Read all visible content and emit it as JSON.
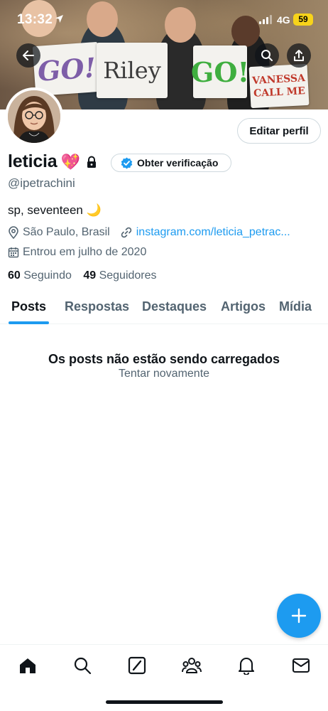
{
  "status_bar": {
    "time": "13:32",
    "network": "4G",
    "battery": "59"
  },
  "banner": {
    "signs": [
      "GO!",
      "Riley",
      "GO!",
      "VANESSA CALL ME"
    ]
  },
  "profile": {
    "display_name": "leticia",
    "name_emoji": "💖",
    "edit_label": "Editar perfil",
    "verify_label": "Obter verificação",
    "handle": "@ipetrachini",
    "bio": "sp, seventeen 🌙",
    "location": "São Paulo, Brasil",
    "website": "instagram.com/leticia_petrac...",
    "joined": "Entrou em julho de 2020",
    "following_count": "60",
    "following_label": "Seguindo",
    "followers_count": "49",
    "followers_label": "Seguidores"
  },
  "tabs": [
    {
      "label": "Posts",
      "active": true
    },
    {
      "label": "Respostas",
      "active": false
    },
    {
      "label": "Destaques",
      "active": false
    },
    {
      "label": "Artigos",
      "active": false
    },
    {
      "label": "Mídia",
      "active": false
    }
  ],
  "feed": {
    "empty_title": "Os posts não estão sendo carregados",
    "retry_label": "Tentar novamente"
  },
  "icons": {
    "back": "arrow-left-icon",
    "search": "search-icon",
    "share": "share-icon",
    "lock": "lock-icon",
    "verified": "verified-badge-icon",
    "location": "location-pin-icon",
    "link": "link-icon",
    "calendar": "calendar-icon",
    "compose": "plus-icon",
    "nav": [
      "home-icon",
      "search-icon",
      "grok-icon",
      "communities-icon",
      "notifications-icon",
      "messages-icon"
    ]
  },
  "colors": {
    "accent": "#1d9bf0",
    "text": "#0f1419",
    "muted": "#536471",
    "battery": "#f7d31a"
  }
}
